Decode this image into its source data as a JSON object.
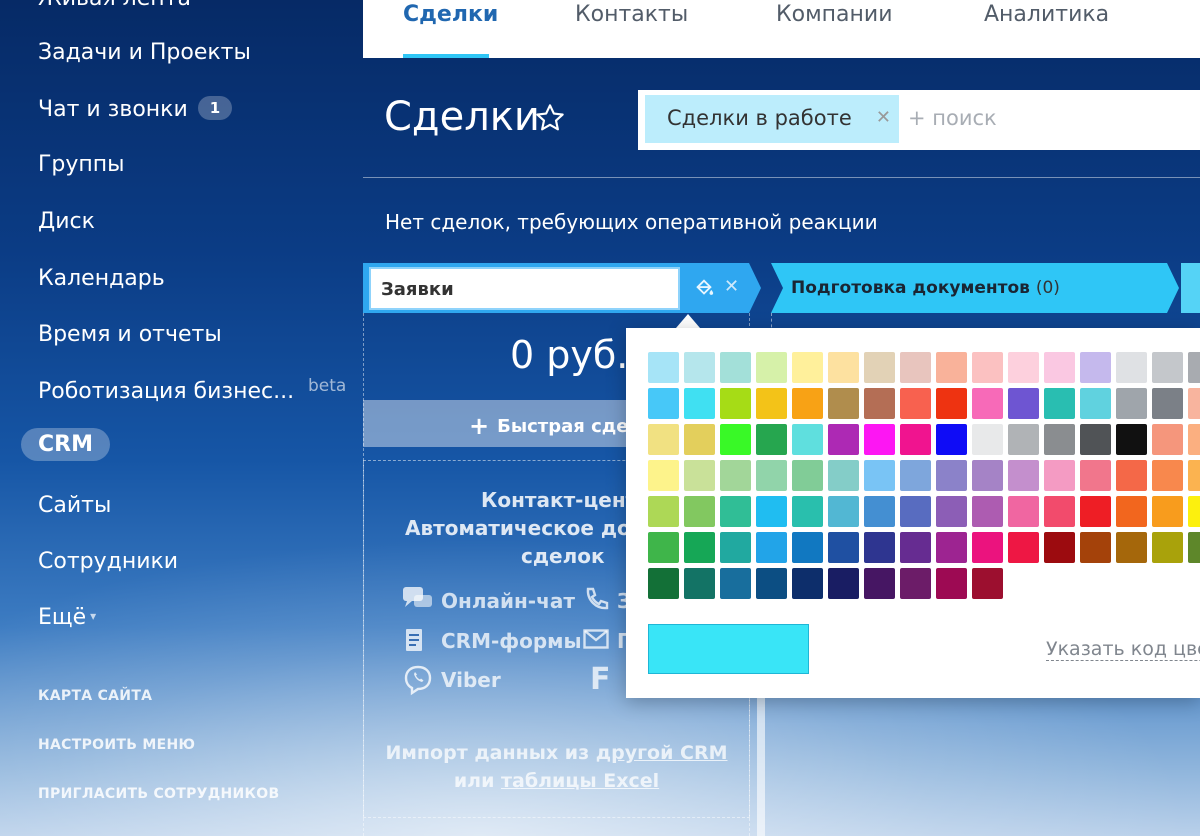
{
  "sidebar": {
    "items": [
      {
        "label": "Живая лента"
      },
      {
        "label": "Задачи и Проекты"
      },
      {
        "label": "Чат и звонки",
        "badge": "1"
      },
      {
        "label": "Группы"
      },
      {
        "label": "Диск"
      },
      {
        "label": "Календарь"
      },
      {
        "label": "Время и отчеты"
      },
      {
        "label": "Роботизация бизнес...",
        "tag": "beta"
      },
      {
        "label": "CRM",
        "active": true
      },
      {
        "label": "Сайты"
      },
      {
        "label": "Сотрудники"
      },
      {
        "label": "Ещё"
      }
    ],
    "links": [
      "КАРТА САЙТА",
      "НАСТРОИТЬ МЕНЮ",
      "ПРИГЛАСИТЬ СОТРУДНИКОВ"
    ]
  },
  "topnav": {
    "tabs": [
      {
        "label": "Сделки",
        "active": true
      },
      {
        "label": "Контакты"
      },
      {
        "label": "Компании"
      },
      {
        "label": "Аналитика"
      }
    ]
  },
  "page": {
    "title": "Сделки",
    "filter_tag": "Сделки в работе",
    "search_placeholder": "+ поиск",
    "notice": "Нет сделок, требующих оперативной реакции"
  },
  "kanban": {
    "column1": {
      "title_input": "Заявки",
      "sum": "0 руб.",
      "quick_deal": "Быстрая сдел",
      "contact_center": {
        "line1": "Контакт-центр",
        "line2": "Автоматическое доба",
        "line3": "сделок"
      },
      "sources": [
        "Онлайн-чат",
        "CRM-формы",
        "Viber",
        "З",
        "П",
        "F"
      ],
      "import": {
        "prefix": "Импорт данных из ",
        "link1": "другой CRM",
        "mid": "или ",
        "link2": "таблицы Excel"
      }
    },
    "column2": {
      "title": "Подготовка документов",
      "count": "(0)"
    }
  },
  "color_picker": {
    "selected_color": "#39e5f7",
    "hex_link": "Указать код цвета",
    "palette": [
      [
        "#a6e4f7",
        "#b5e6ec",
        "#a3e0d9",
        "#d6f1a9",
        "#fff09b",
        "#fde1a0",
        "#e2d2b6",
        "#e8c5be",
        "#f9b29a",
        "#fbc1c1",
        "#fdd0dd",
        "#fac8e2",
        "#c5b9ed",
        "#dfe1e4",
        "#c4c7cb",
        "#a8abb0"
      ],
      [
        "#ffffff",
        "#47c8f8",
        "#40e0f2",
        "#a6dc16",
        "#f3c318",
        "#f8a215",
        "#b08d4d",
        "#b46e55",
        "#f8614f",
        "#ee3311",
        "#f76ab8",
        "#6e55d2",
        "#29beb1",
        "#60d2df",
        "#9fa5ab",
        "#7b8087"
      ],
      [
        "#f8b49e",
        "#fdbf95",
        "#f1e182",
        "#e3cf5c",
        "#39f927",
        "#26a64f",
        "#5fdfde",
        "#ad29b4",
        "#fd16f3",
        "#f0148f",
        "#0f0cf6",
        "#e8e9ea",
        "#b0b3b6",
        "#8a8d90",
        "#505356",
        "#111111"
      ],
      [
        "#f5967c",
        "#fbaf80",
        "#fdc58b",
        "#fdf38b",
        "#c9e199",
        "#a2d699",
        "#91d4aa",
        "#81cc97",
        "#84cdc8",
        "#79c4f5",
        "#7ea6dc",
        "#8b82c9",
        "#a583c6",
        "#c48fcd",
        "#f49bc3",
        "#f1768c"
      ],
      [
        "#f46848",
        "#f8884d",
        "#fbb350",
        "#fef251",
        "#add856",
        "#82c860",
        "#30be96",
        "#20bdf1",
        "#29bfad",
        "#52b7d3",
        "#448fd2",
        "#586cc0",
        "#8c5eb6",
        "#ad5cb1",
        "#f066a1",
        "#f24b6c"
      ],
      [
        "#ee1e25",
        "#f2661e",
        "#f89c1d",
        "#fcf00e",
        "#92c83e",
        "#3fb54a",
        "#16a756",
        "#21a9a0",
        "#22a4e8",
        "#1178c1",
        "#1f50a2",
        "#2e3590",
        "#662c91",
        "#9d2491",
        "#eb137e",
        "#ee1744"
      ],
      [
        "#9c0b0f",
        "#a4420a",
        "#a5670b",
        "#a9a20b",
        "#5e872a",
        "#268233",
        "#137037",
        "#137365",
        "#186e9d",
        "#0c4e83",
        "#0d2e6b",
        "#191d63",
        "#461663",
        "#6c1c68",
        "#9d0a53",
        "#9c0f2f"
      ]
    ]
  },
  "colors": {
    "column1_header": "#2fa7f0",
    "column2_header": "#2fc6f6",
    "active_tab": "#2067b0",
    "tab_underline": "#2fc6f6",
    "filter_tag_bg": "#bcedfc"
  }
}
